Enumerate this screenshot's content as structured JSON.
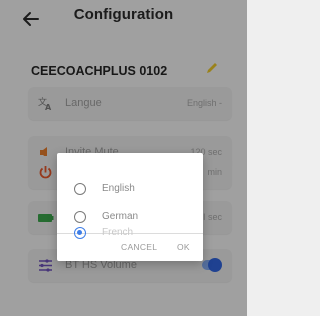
{
  "header": {
    "title": "Configuration",
    "back_icon": "back-arrow-icon"
  },
  "device": {
    "name": "CEECOACHPLUS 0102",
    "edit_icon": "pencil-icon",
    "edit_color": "#e6c229"
  },
  "settings": [
    {
      "icon": "translate-icon",
      "label": "Langue",
      "value": "English -"
    },
    {
      "icon": "volume-icon",
      "label": "Invite Mute",
      "value": "120 sec"
    },
    {
      "icon": "power-icon",
      "label": "",
      "value": "min"
    },
    {
      "icon": "battery-icon",
      "label": "",
      "value": "I sec"
    },
    {
      "icon": "sliders-icon",
      "label": "BT HS Volume",
      "value": ""
    }
  ],
  "dialog": {
    "options": [
      {
        "label": "English",
        "selected": false
      },
      {
        "label": "German",
        "selected": false
      },
      {
        "label": "French",
        "selected": true
      }
    ],
    "cancel": "CANCEL",
    "ok": "OK"
  },
  "colors": {
    "accent": "#3e7ee8",
    "power": "#e0552a",
    "volume": "#e07a2a",
    "battery": "#3aa14a"
  }
}
